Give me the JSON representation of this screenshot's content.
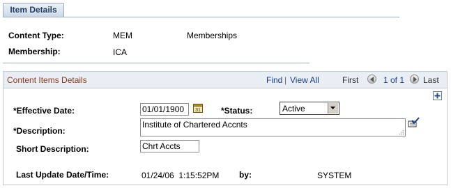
{
  "tab": {
    "label": "Item Details"
  },
  "header": {
    "content_type_label": "Content Type:",
    "content_type_code": "MEM",
    "content_type_desc": "Memberships",
    "membership_label": "Membership:",
    "membership_value": "ICA"
  },
  "scroll": {
    "title": "Content Items Details",
    "find": "Find",
    "separator": "|",
    "view_all": "View All",
    "first": "First",
    "count": "1 of 1",
    "last": "Last"
  },
  "form": {
    "effective_date_label": "*Effective Date:",
    "effective_date_value": "01/01/1900",
    "status_label": "*Status:",
    "status_value": "Active",
    "description_label": "*Description:",
    "description_value": "Institute of Chartered Accnts",
    "short_description_label": "Short Description:",
    "short_description_value": "Chrt Accts",
    "last_update_label": "Last Update Date/Time:",
    "last_update_value": "01/24/06  1:15:52PM",
    "by_label": "by:",
    "by_value": "SYSTEM"
  },
  "icons": {
    "calendar": "calendar-icon",
    "spellcheck": "spell-check-icon",
    "prev": "previous-arrow-icon",
    "next": "next-arrow-icon",
    "add": "add-row-icon",
    "dropdown": "dropdown-arrow-icon"
  },
  "colors": {
    "title_text": "#8b3a1a",
    "link": "#1a3f8f",
    "tab_text": "#1f3b66",
    "header_bg": "#e9edf4"
  }
}
